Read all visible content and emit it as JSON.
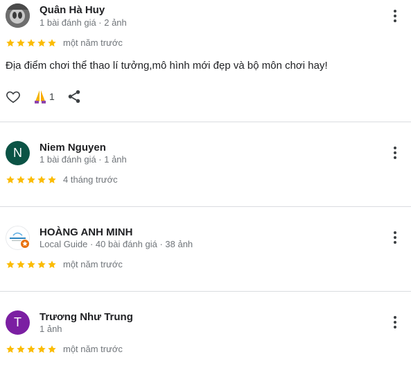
{
  "colors": {
    "star": "#fbbc04",
    "muted": "#70757a",
    "divider": "#dadce0"
  },
  "reviews": [
    {
      "name": "Quân Hà Huy",
      "meta": "1 bài đánh giá · 2 ảnh",
      "avatar_letter": "",
      "avatar_type": "photo",
      "rating": 5,
      "when": "một năm trước",
      "text": "Địa điểm chơi thể thao lí tưởng,mô hình mới đẹp và bộ môn chơi hay!",
      "reaction_count": "1",
      "icons": [
        "heart-icon",
        "praying-hands-icon",
        "share-icon"
      ]
    },
    {
      "name": "Niem Nguyen",
      "meta": "1 bài đánh giá · 1 ảnh",
      "avatar_letter": "N",
      "avatar_color": "#0b5345",
      "rating": 5,
      "when": "4 tháng trước"
    },
    {
      "name": "HOÀNG ANH MINH",
      "meta": "Local Guide · 40 bài đánh giá · 38 ảnh",
      "avatar_letter": "",
      "avatar_type": "logo",
      "local_guide_badge_color": "#e8710a",
      "rating": 5,
      "when": "một năm trước"
    },
    {
      "name": "Trương Như Trung",
      "meta": "1 ảnh",
      "avatar_letter": "T",
      "avatar_color": "#7b1fa2",
      "rating": 5,
      "when": "một năm trước"
    }
  ]
}
